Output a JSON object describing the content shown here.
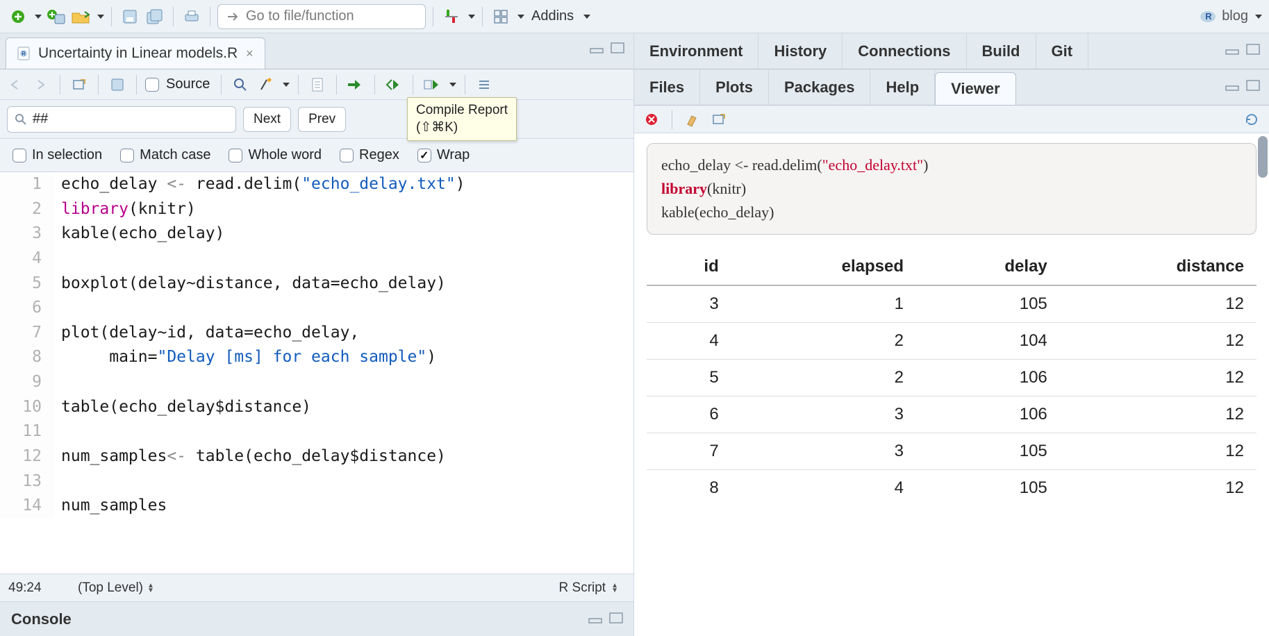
{
  "main_toolbar": {
    "goto_placeholder": "Go to file/function",
    "addins_label": "Addins",
    "project_label": "blog"
  },
  "source": {
    "tab_filename": "Uncertainty in Linear models.R",
    "source_label": "Source",
    "find_value": "##",
    "btn_next": "Next",
    "btn_prev": "Prev",
    "tooltip_line1": "Compile Report",
    "tooltip_line2": "(⇧⌘K)",
    "opt_in_selection": "In selection",
    "opt_match_case": "Match case",
    "opt_whole_word": "Whole word",
    "opt_regex": "Regex",
    "opt_wrap": "Wrap",
    "status_pos": "49:24",
    "status_scope": "(Top Level)",
    "status_lang": "R Script",
    "code_lines": [
      {
        "n": "1",
        "html": "echo_delay <span class='tok-op'>&lt;-</span> read.delim(<span class='tok-str'>\"echo_delay.txt\"</span>)"
      },
      {
        "n": "2",
        "html": "<span class='tok-fun'>library</span>(knitr)"
      },
      {
        "n": "3",
        "html": "kable(echo_delay)"
      },
      {
        "n": "4",
        "html": ""
      },
      {
        "n": "5",
        "html": "boxplot(delay~distance, data=echo_delay)"
      },
      {
        "n": "6",
        "html": ""
      },
      {
        "n": "7",
        "html": "plot(delay~id, data=echo_delay,"
      },
      {
        "n": "8",
        "html": "     main=<span class='tok-str'>\"Delay [ms] for each sample\"</span>)"
      },
      {
        "n": "9",
        "html": ""
      },
      {
        "n": "10",
        "html": "table(echo_delay$distance)"
      },
      {
        "n": "11",
        "html": ""
      },
      {
        "n": "12",
        "html": "num_samples<span class='tok-op'>&lt;-</span> table(echo_delay$distance)"
      },
      {
        "n": "13",
        "html": ""
      },
      {
        "n": "14",
        "html": "num_samples"
      }
    ]
  },
  "console_label": "Console",
  "env_tabs": [
    "Environment",
    "History",
    "Connections",
    "Build",
    "Git"
  ],
  "viewer_tabs": [
    "Files",
    "Plots",
    "Packages",
    "Help",
    "Viewer"
  ],
  "viewer_active": "Viewer",
  "viewer_preview": {
    "line1_pre": "echo_delay <- read.delim(",
    "line1_str": "\"echo_delay.txt\"",
    "line1_post": ")",
    "line2_kw": "library",
    "line2_rest": "(knitr)",
    "line3": "kable(echo_delay)"
  },
  "table": {
    "headers": [
      "id",
      "elapsed",
      "delay",
      "distance"
    ],
    "rows": [
      [
        "3",
        "1",
        "105",
        "12"
      ],
      [
        "4",
        "2",
        "104",
        "12"
      ],
      [
        "5",
        "2",
        "106",
        "12"
      ],
      [
        "6",
        "3",
        "106",
        "12"
      ],
      [
        "7",
        "3",
        "105",
        "12"
      ],
      [
        "8",
        "4",
        "105",
        "12"
      ]
    ]
  }
}
